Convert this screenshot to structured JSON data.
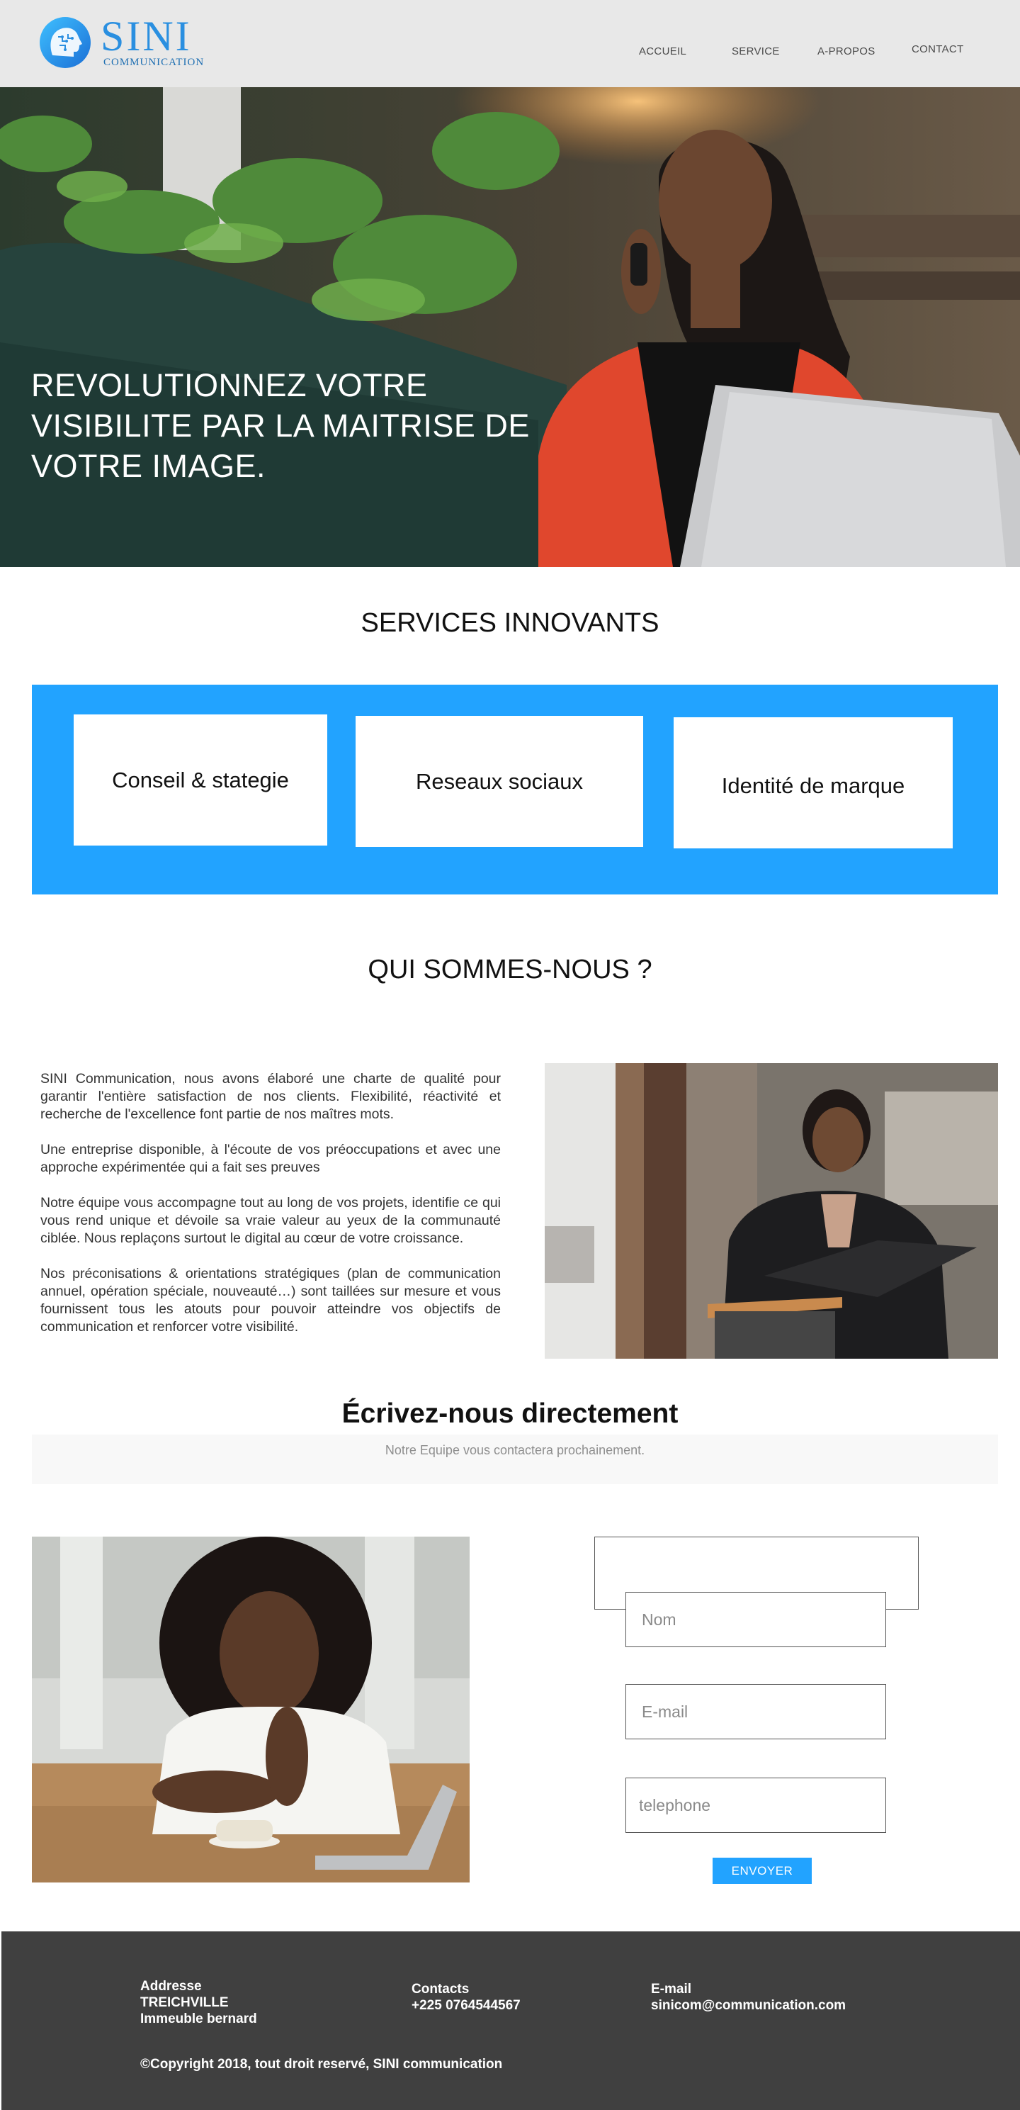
{
  "brand": {
    "name": "SINI",
    "subtitle": "COMMUNICATION"
  },
  "nav": {
    "items": [
      "ACCUEIL",
      "SERVICE",
      "A-PROPOS",
      "CONTACT"
    ]
  },
  "hero": {
    "title_line1": "REVOLUTIONNEZ VOTRE",
    "title_line2": "VISIBILITE PAR LA MAITRISE DE",
    "title_line3": "VOTRE IMAGE."
  },
  "services": {
    "title": "SERVICES INNOVANTS",
    "cards": [
      "Conseil & stategie",
      "Reseaux sociaux",
      "Identité de marque"
    ]
  },
  "about": {
    "title": "QUI SOMMES-NOUS ?",
    "paragraphs": [
      "SINI Communication, nous avons élaboré une charte de qualité pour garantir l'entière satisfaction de nos clients. Flexibilité, réactivité et recherche de l'excellence font partie de nos maîtres mots.",
      "Une entreprise disponible, à l'écoute de vos préoccupations et avec une approche expérimentée qui a fait ses preuves",
      "Notre équipe vous accompagne tout au long de vos projets, identifie ce qui vous rend unique et dévoile sa vraie valeur au yeux de la communauté ciblée. Nous replaçons surtout le digital au cœur de votre croissance.",
      "Nos préconisations & orientations stratégiques (plan de communication annuel, opération spéciale, nouveauté…) sont taillées sur mesure et vous fournissent tous les atouts pour pouvoir atteindre vos objectifs de communication et renforcer votre visibilité."
    ]
  },
  "contact": {
    "title": "Écrivez-nous directement",
    "subtitle": "Notre Equipe vous contactera prochainement.",
    "name_placeholder": "Nom",
    "email_placeholder": "E-mail",
    "phone_placeholder": "telephone",
    "submit_label": "ENVOYER"
  },
  "footer": {
    "address_label": "Addresse",
    "address_line1": "TREICHVILLE",
    "address_line2": "Immeuble bernard",
    "contacts_label": "Contacts",
    "phone": "+225 0764544567",
    "email_label": "E-mail",
    "email": "sinicom@communication.com",
    "copyright": "©Copyright 2018, tout droit reservé, SINI communication"
  },
  "colors": {
    "accent": "#22a3ff",
    "header_bg": "#e8e8e8",
    "footer_bg": "#404040"
  }
}
